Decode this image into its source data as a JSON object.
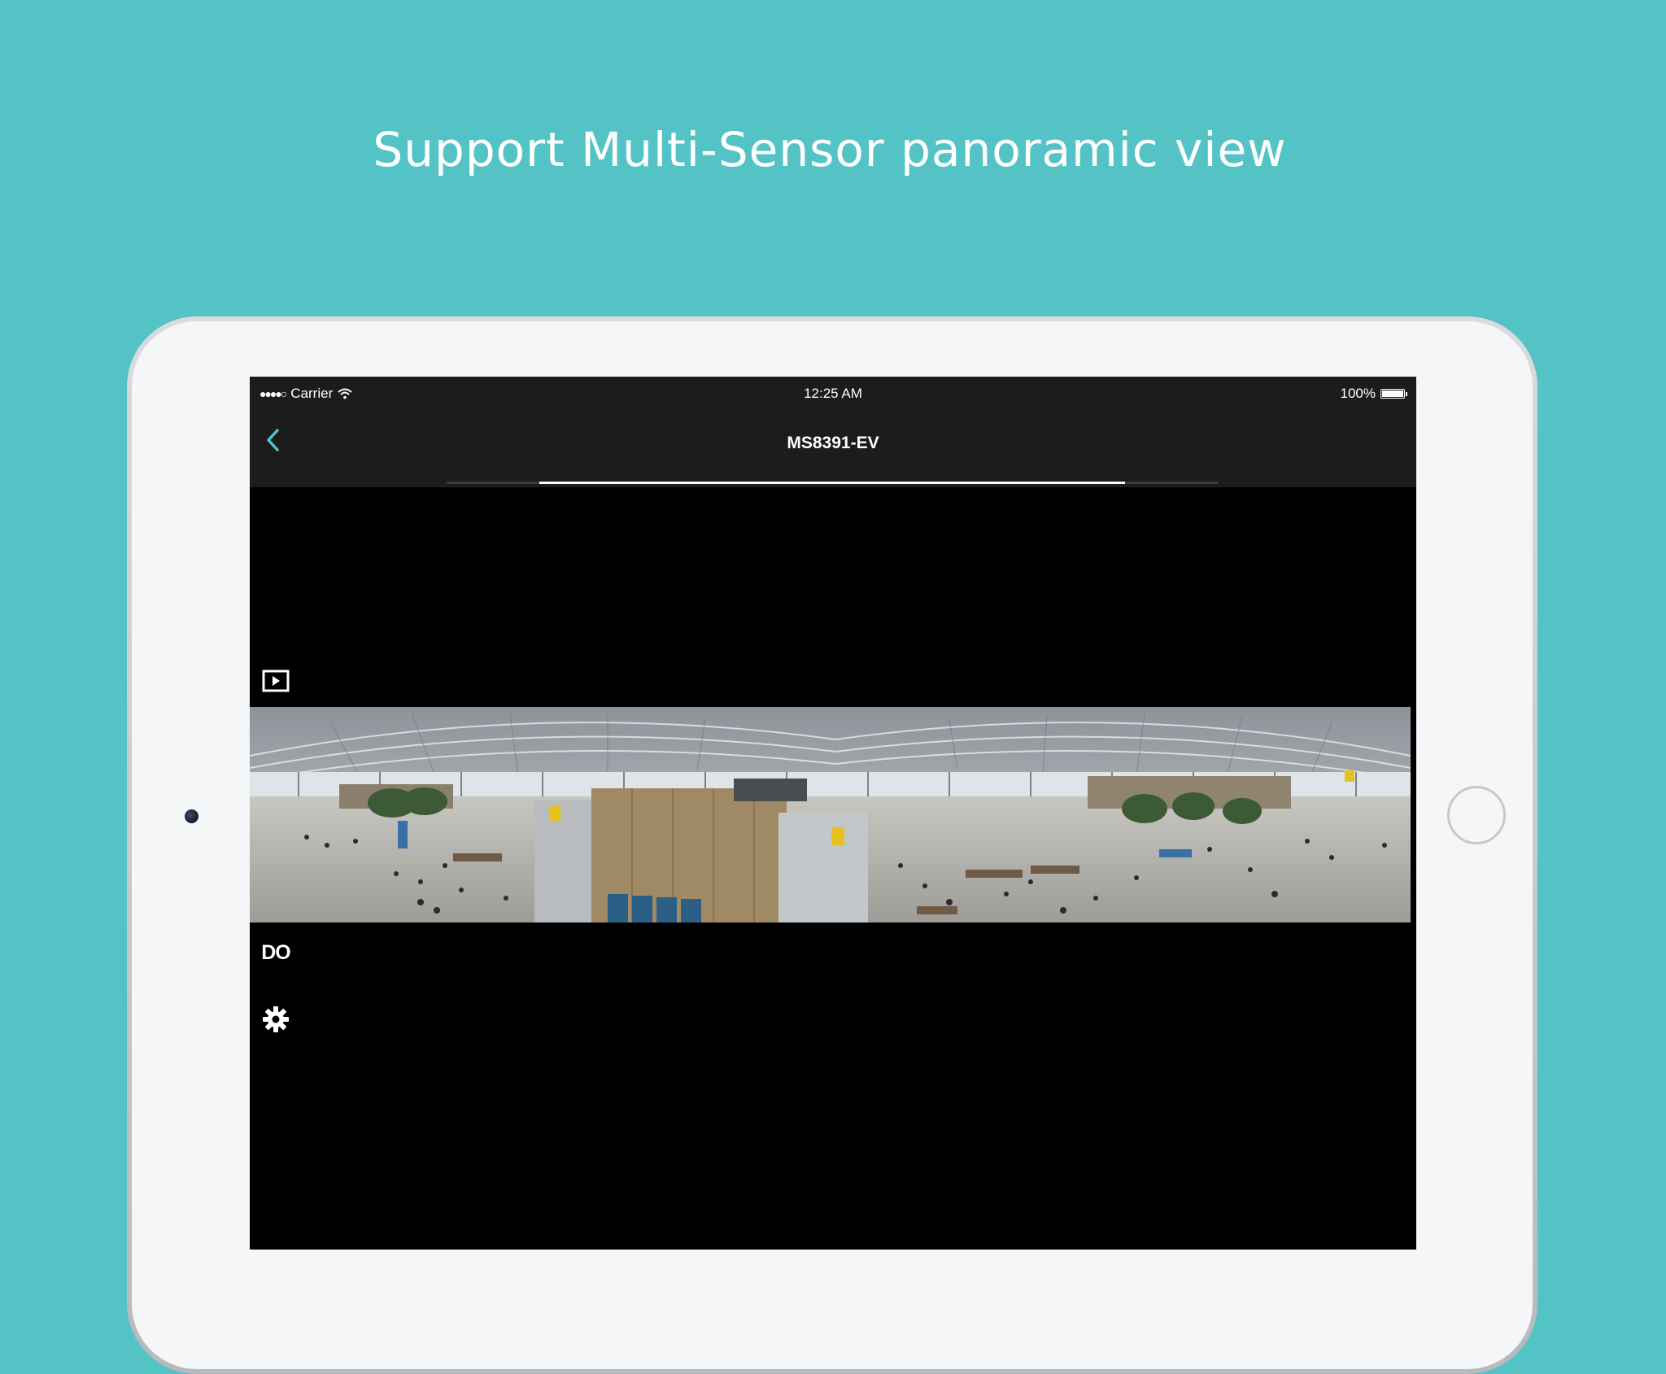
{
  "headline": "Support Multi-Sensor panoramic view",
  "status_bar": {
    "signal": "●●●●○",
    "carrier": "Carrier",
    "time": "12:25 AM",
    "battery_text": "100%",
    "battery_level": 1.0
  },
  "nav": {
    "title": "MS8391-EV",
    "back_icon": "chevron-left-icon"
  },
  "timeline": {
    "start": 0.12,
    "end": 0.88
  },
  "toolbar": {
    "items": [
      {
        "name": "playback",
        "icon": "play-box-icon"
      },
      {
        "name": "layout",
        "icon": "layout-icon"
      },
      {
        "name": "snapshot",
        "icon": "camera-icon"
      },
      {
        "name": "audio",
        "icon": "microphone-icon"
      },
      {
        "name": "digital-output",
        "label": "DO"
      },
      {
        "name": "settings",
        "icon": "gear-icon"
      }
    ]
  },
  "panorama": {
    "description_icon": "panoramic-camera-view"
  },
  "colors": {
    "background": "#54c3c6",
    "accent": "#4fc3c7",
    "bar": "#1c1c1c"
  }
}
